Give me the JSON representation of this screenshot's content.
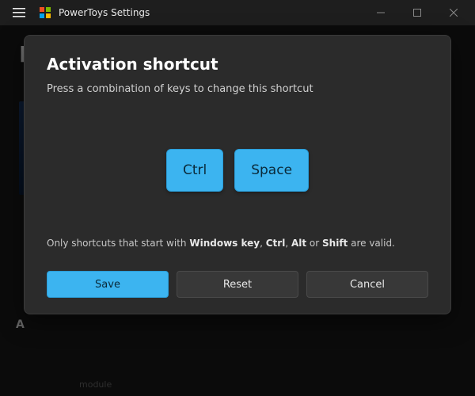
{
  "titlebar": {
    "app_title": "PowerToys Settings"
  },
  "bg": {
    "page_heading_letter": "P",
    "section_letter": "A",
    "module_hint": "module"
  },
  "modal": {
    "title": "Activation shortcut",
    "subtitle": "Press a combination of keys to change this shortcut",
    "keys": [
      "Ctrl",
      "Space"
    ],
    "hint_prefix": "Only shortcuts that start with ",
    "hint_keys": [
      "Windows key",
      "Ctrl",
      "Alt",
      "Shift"
    ],
    "hint_suffix": " are valid.",
    "buttons": {
      "save": "Save",
      "reset": "Reset",
      "cancel": "Cancel"
    }
  }
}
